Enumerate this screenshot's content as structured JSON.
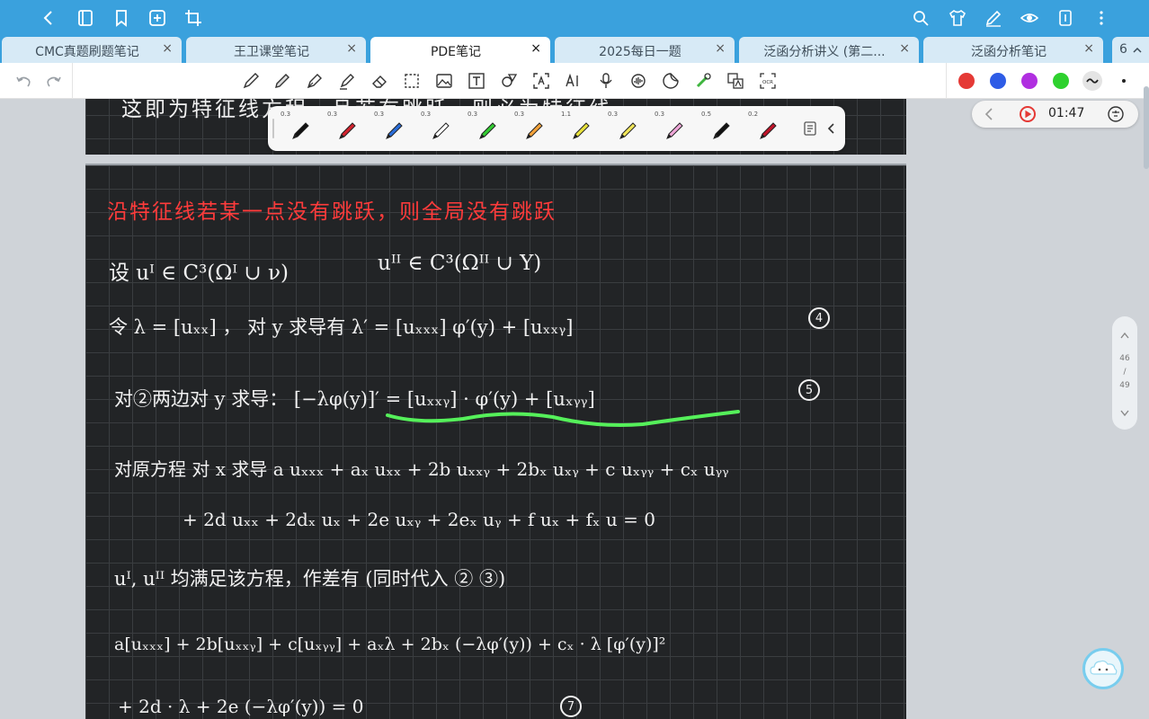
{
  "tabs": [
    {
      "label": "CMC真题刷题笔记",
      "close": "×"
    },
    {
      "label": "王卫课堂笔记",
      "close": "×"
    },
    {
      "label": "PDE笔记",
      "close": "×"
    },
    {
      "label": "2025每日一题",
      "close": "×"
    },
    {
      "label": "泛函分析讲义 (第二...",
      "close": "×"
    },
    {
      "label": "泛函分析笔记",
      "close": "×"
    }
  ],
  "tab_overflow": "6",
  "active_tab_index": 2,
  "toolbar_colors": [
    "#e53935",
    "#2e5ce6",
    "#b02fe0",
    "#2ed12e"
  ],
  "pens": [
    {
      "size": "0.3",
      "color": "#111111"
    },
    {
      "size": "0.3",
      "color": "#d3232f"
    },
    {
      "size": "0.3",
      "color": "#2a6dd9"
    },
    {
      "size": "0.3",
      "color": "#ffffff"
    },
    {
      "size": "0.3",
      "color": "#33cc33"
    },
    {
      "size": "0.3",
      "color": "#f3a23a"
    },
    {
      "size": "1.1",
      "color": "#e9e23c"
    },
    {
      "size": "0.3",
      "color": "#f1e65a"
    },
    {
      "size": "0.3",
      "color": "#f0a7d9"
    },
    {
      "size": "0.5",
      "color": "#111111"
    },
    {
      "size": "0.2",
      "color": "#c0142a"
    }
  ],
  "recorder": {
    "time": "01:47"
  },
  "pagenav": {
    "current": "46",
    "sep": "/",
    "total": "49"
  },
  "note": {
    "line_top": "这即为特征线方程，且若有跳跃，则必为特征线。",
    "line_red": "沿特征线若某一点没有跳跃，则全局没有跳跃",
    "line1a": "设  uᴵ ∈ C³(Ωᴵ ∪ ν)",
    "line1b": "uᴵᴵ ∈ C³(Ωᴵᴵ ∪ Y)",
    "line2": "令  λ = [uₓₓ] ，   对 y 求导有   λ′ =  [uₓₓₓ] φ′(y)  +  [uₓₓᵧ]",
    "mark4": "4",
    "line3": "对②两边对 y 求导：  [−λφ(y)]′ =  [uₓₓᵧ] · φ′(y)  +  [uₓᵧᵧ]",
    "mark5": "5",
    "line4": "对原方程 对 x 求导   a uₓₓₓ + aₓ uₓₓ + 2b uₓₓᵧ + 2bₓ uₓᵧ  + c uₓᵧᵧ + cₓ uᵧᵧ",
    "line5": "+ 2d uₓₓ  +  2dₓ uₓ  +  2e uₓᵧ  +  2eₓ uᵧ  +  f uₓ  +  fₓ u  = 0",
    "line6": "uᴵ, uᴵᴵ 均满足该方程，作差有 (同时代入 ② ③)",
    "line7": "a[uₓₓₓ] + 2b[uₓₓᵧ] + c[uₓᵧᵧ] + aₓλ + 2bₓ (−λφ′(y)) + cₓ · λ [φ′(y)]²",
    "line8": "+ 2d · λ   +  2e (−λφ′(y))   = 0",
    "mark7": "7"
  }
}
